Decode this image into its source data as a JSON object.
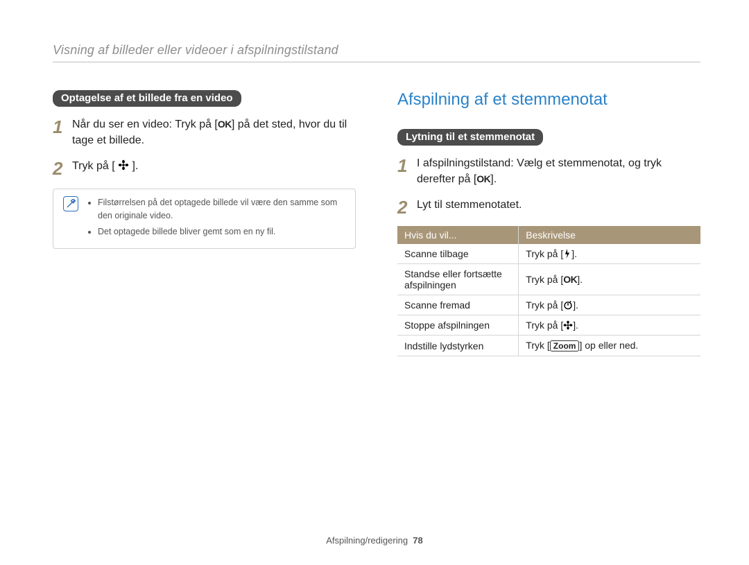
{
  "breadcrumb": "Visning af billeder eller videoer i afspilningstilstand",
  "left": {
    "pill": "Optagelse af et billede fra en video",
    "step1_a": "Når du ser en video: Tryk på [",
    "step1_b": "] på det sted, hvor du til tage et billede.",
    "step2_a": "Tryk på [",
    "step2_b": "].",
    "note1": "Filstørrelsen på det optagede billede vil være den samme som den originale video.",
    "note2": "Det optagede billede bliver gemt som en ny fil."
  },
  "right": {
    "title": "Afspilning af et stemmenotat",
    "pill": "Lytning til et stemmenotat",
    "step1_a": "I afspilningstilstand: Vælg et stemmenotat, og tryk derefter på [",
    "step1_b": "].",
    "step2": "Lyt til stemmenotatet.",
    "th1": "Hvis du vil...",
    "th2": "Beskrivelse",
    "rows": [
      {
        "a": "Scanne tilbage",
        "b_pre": "Tryk på [",
        "b_post": "].",
        "icon": "flash"
      },
      {
        "a": "Standse eller fortsætte afspilningen",
        "b_pre": "Tryk på [",
        "b_post": "].",
        "icon": "ok"
      },
      {
        "a": "Scanne fremad",
        "b_pre": "Tryk på [",
        "b_post": "].",
        "icon": "timer"
      },
      {
        "a": "Stoppe afspilningen",
        "b_pre": "Tryk på [",
        "b_post": "].",
        "icon": "flower"
      },
      {
        "a": "Indstille lydstyrken",
        "b_pre": "Tryk [",
        "b_zoom": "Zoom",
        "b_post": "] op eller ned.",
        "icon": "none"
      }
    ]
  },
  "footer": {
    "section": "Afspilning/redigering",
    "page": "78"
  },
  "icons": {
    "ok": "OK"
  }
}
